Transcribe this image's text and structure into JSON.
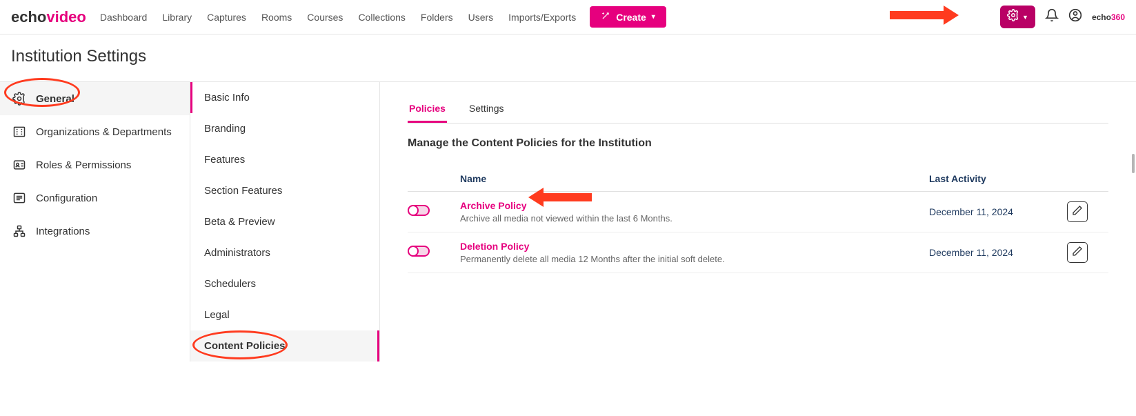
{
  "brand": {
    "part1": "echo",
    "part2": "video"
  },
  "nav": {
    "items": [
      "Dashboard",
      "Library",
      "Captures",
      "Rooms",
      "Courses",
      "Collections",
      "Folders",
      "Users",
      "Imports/Exports"
    ]
  },
  "create_button": {
    "label": "Create"
  },
  "footer_brand": {
    "part1": "echo",
    "part2": "360"
  },
  "page_title": "Institution Settings",
  "sidebar1": {
    "items": [
      {
        "label": "General",
        "name": "sidebar-item-general",
        "active": true
      },
      {
        "label": "Organizations & Departments",
        "name": "sidebar-item-orgs"
      },
      {
        "label": "Roles & Permissions",
        "name": "sidebar-item-roles"
      },
      {
        "label": "Configuration",
        "name": "sidebar-item-configuration"
      },
      {
        "label": "Integrations",
        "name": "sidebar-item-integrations"
      }
    ]
  },
  "sidebar2": {
    "items": [
      {
        "label": "Basic Info",
        "name": "sub-item-basic-info",
        "indicator": true
      },
      {
        "label": "Branding",
        "name": "sub-item-branding"
      },
      {
        "label": "Features",
        "name": "sub-item-features"
      },
      {
        "label": "Section Features",
        "name": "sub-item-section-features"
      },
      {
        "label": "Beta & Preview",
        "name": "sub-item-beta-preview"
      },
      {
        "label": "Administrators",
        "name": "sub-item-administrators"
      },
      {
        "label": "Schedulers",
        "name": "sub-item-schedulers"
      },
      {
        "label": "Legal",
        "name": "sub-item-legal"
      },
      {
        "label": "Content Policies",
        "name": "sub-item-content-policies",
        "active": true
      }
    ]
  },
  "tabs": {
    "items": [
      {
        "label": "Policies",
        "name": "tab-policies",
        "active": true
      },
      {
        "label": "Settings",
        "name": "tab-settings"
      }
    ]
  },
  "section_heading": "Manage the Content Policies for the Institution",
  "table": {
    "headers": {
      "name": "Name",
      "last_activity": "Last Activity"
    },
    "rows": [
      {
        "title": "Archive Policy",
        "desc": "Archive all media not viewed within the last 6 Months.",
        "date": "December 11, 2024"
      },
      {
        "title": "Deletion Policy",
        "desc": "Permanently delete all media 12 Months after the initial soft delete.",
        "date": "December 11, 2024"
      }
    ]
  }
}
